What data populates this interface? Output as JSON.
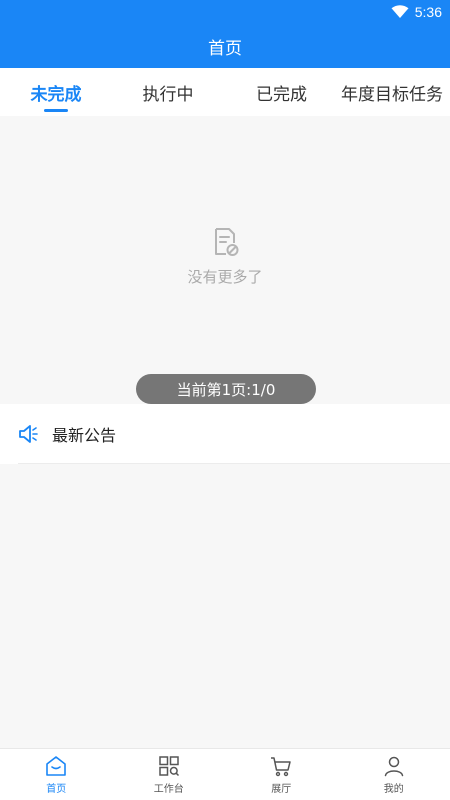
{
  "status_bar": {
    "time": "5:36",
    "icon": "wifi-icon"
  },
  "header": {
    "title": "首页"
  },
  "tabs": [
    {
      "label": "未完成",
      "active": true
    },
    {
      "label": "执行中",
      "active": false
    },
    {
      "label": "已完成",
      "active": false
    },
    {
      "label": "年度目标任务",
      "active": false
    }
  ],
  "empty_state": {
    "icon": "empty-document-icon",
    "text": "没有更多了"
  },
  "pagination": {
    "text": "当前第1页:1/0"
  },
  "notice": {
    "icon": "speaker-icon",
    "title": "最新公告"
  },
  "bottom_nav": [
    {
      "label": "首页",
      "icon": "home-icon",
      "active": true
    },
    {
      "label": "工作台",
      "icon": "workbench-icon",
      "active": false
    },
    {
      "label": "展厅",
      "icon": "cart-icon",
      "active": false
    },
    {
      "label": "我的",
      "icon": "user-icon",
      "active": false
    }
  ],
  "colors": {
    "primary": "#1a86f6",
    "muted_text": "#aaaaaa",
    "pill_bg": "#767676"
  }
}
